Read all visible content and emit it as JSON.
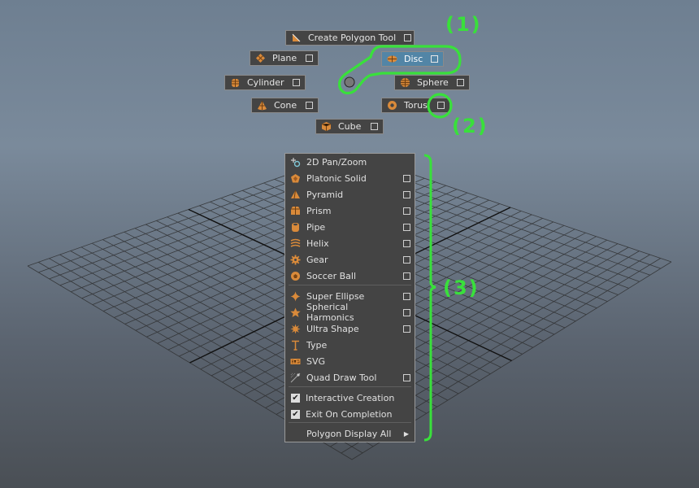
{
  "marking_menu": {
    "create_polygon_tool": "Create Polygon Tool",
    "plane": "Plane",
    "disc": "Disc",
    "cylinder": "Cylinder",
    "sphere": "Sphere",
    "cone": "Cone",
    "torus": "Torus",
    "cube": "Cube"
  },
  "overflow_menu": {
    "items": [
      {
        "label": "2D Pan/Zoom",
        "icon": "pan-zoom-icon",
        "option_box": false
      },
      {
        "label": "Platonic Solid",
        "icon": "platonic-solid-icon",
        "option_box": true
      },
      {
        "label": "Pyramid",
        "icon": "pyramid-icon",
        "option_box": true
      },
      {
        "label": "Prism",
        "icon": "prism-icon",
        "option_box": true
      },
      {
        "label": "Pipe",
        "icon": "pipe-icon",
        "option_box": true
      },
      {
        "label": "Helix",
        "icon": "helix-icon",
        "option_box": true
      },
      {
        "label": "Gear",
        "icon": "gear-icon",
        "option_box": true
      },
      {
        "label": "Soccer Ball",
        "icon": "soccer-ball-icon",
        "option_box": true
      },
      {
        "label": "Super Ellipse",
        "icon": "super-ellipse-icon",
        "option_box": true
      },
      {
        "label": "Spherical Harmonics",
        "icon": "spherical-harmonics-icon",
        "option_box": true
      },
      {
        "label": "Ultra Shape",
        "icon": "ultra-shape-icon",
        "option_box": true
      },
      {
        "label": "Type",
        "icon": "type-icon",
        "option_box": false
      },
      {
        "label": "SVG",
        "icon": "svg-icon",
        "option_box": false
      },
      {
        "label": "Quad Draw Tool",
        "icon": "quad-draw-icon",
        "option_box": true
      }
    ],
    "toggles": [
      {
        "label": "Interactive Creation",
        "checked": true
      },
      {
        "label": "Exit On Completion",
        "checked": true
      }
    ],
    "submenu": "Polygon Display All"
  },
  "annotations": {
    "one": "(1)",
    "two": "(2)",
    "three": "(3)"
  },
  "colors": {
    "accent": "#39e03b",
    "icon_orange": "#d98a3a",
    "selected": "#5285a6"
  }
}
